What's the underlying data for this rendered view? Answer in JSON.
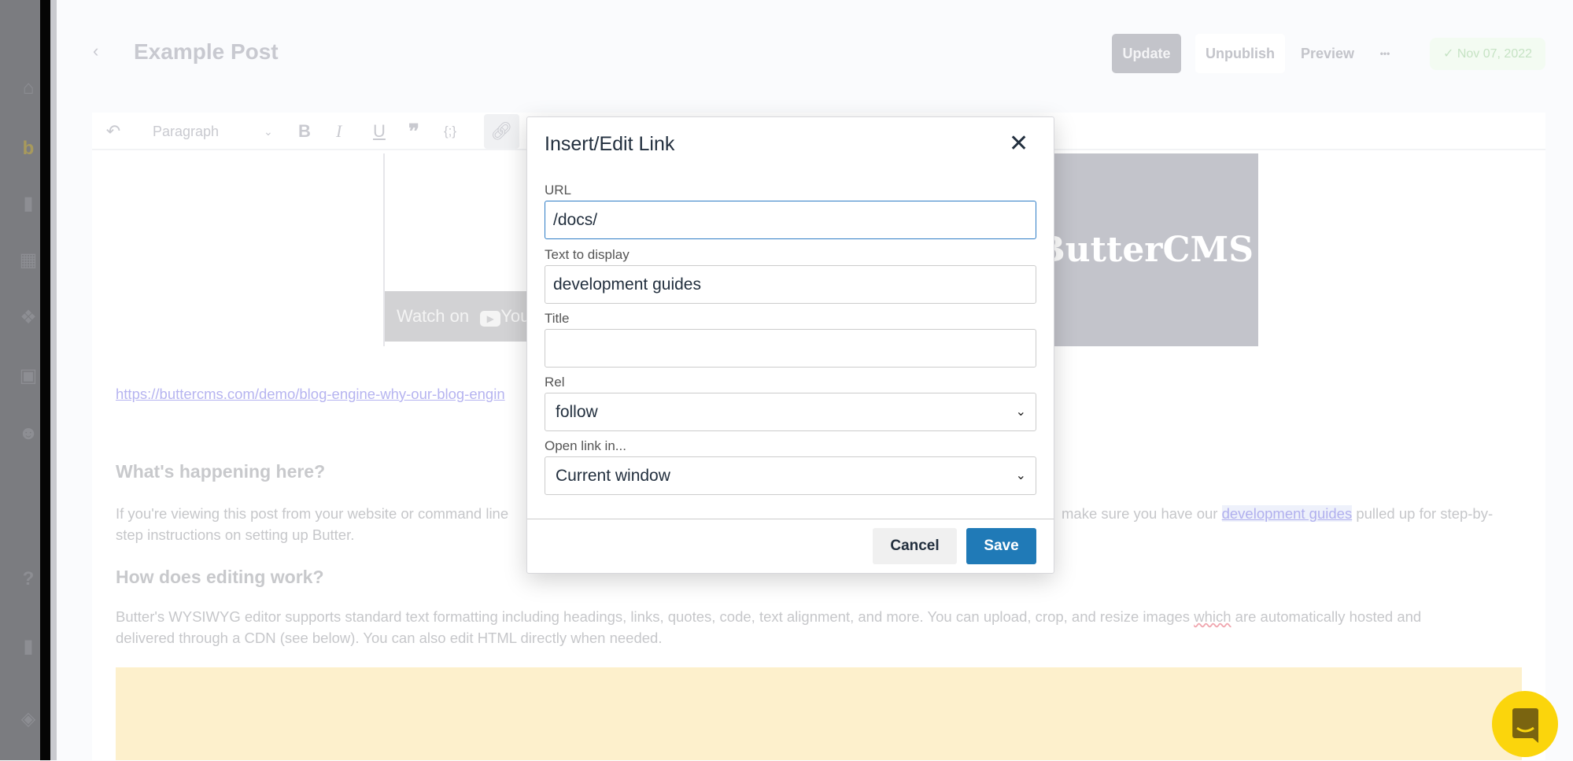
{
  "header": {
    "title": "Example Post",
    "update": "Update",
    "unpublish": "Unpublish",
    "preview": "Preview",
    "more": "•••",
    "date": "✓ Nov 07, 2022"
  },
  "toolbar": {
    "block_format": "Paragraph"
  },
  "content": {
    "video_watch": "Watch on",
    "video_brand": "You",
    "image_text": "ButterCMS",
    "url_link": "https://buttercms.com/demo/blog-engine-why-our-blog-engin",
    "heading1": "What's happening here?",
    "para1_left": "If you're viewing this post from your website or command line",
    "para1_right_a": "make sure you have our",
    "para1_link": "development guides",
    "para1_right_b": "pulled up for step-by-",
    "para1_line2": "step instructions on setting up Butter.",
    "heading2": "How does editing work?",
    "para2_line1a": "Butter's WYSIWYG editor supports standard text formatting including headings, links, quotes, code, text alignment, and more. You can upload, crop, and resize images ",
    "para2_spell": "which",
    "para2_line1b": " are automatically hosted and",
    "para2_line2": "delivered through a CDN (see below). You can also edit HTML directly when needed."
  },
  "dialog": {
    "title": "Insert/Edit Link",
    "url_label": "URL",
    "url_value": "/docs/",
    "text_label": "Text to display",
    "text_value": "development guides",
    "title_label": "Title",
    "title_value": "",
    "rel_label": "Rel",
    "rel_value": "follow",
    "target_label": "Open link in...",
    "target_value": "Current window",
    "cancel": "Cancel",
    "save": "Save"
  },
  "colors": {
    "save": "#207ab7",
    "chat": "#fbd50c",
    "link": "#b1b0ee"
  }
}
